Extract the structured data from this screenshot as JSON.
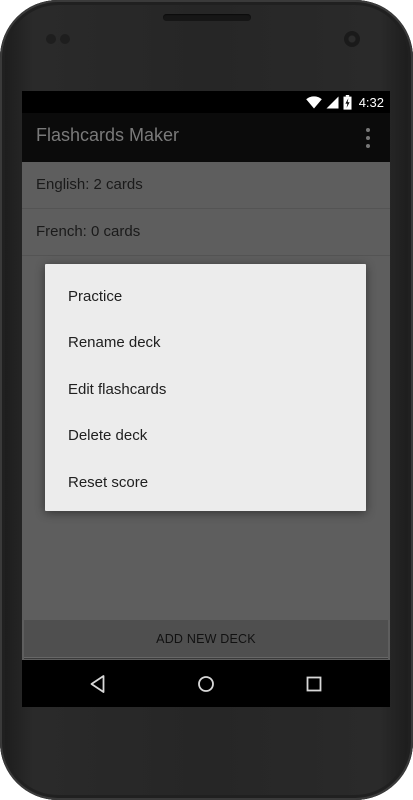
{
  "status_bar": {
    "time": "4:32",
    "icons": [
      "wifi-icon",
      "cell-signal-icon",
      "battery-charging-icon"
    ]
  },
  "action_bar": {
    "title": "Flashcards Maker",
    "overflow_icon": "more-vert-icon"
  },
  "decks": [
    {
      "label": "English: 2 cards"
    },
    {
      "label": "French: 0 cards"
    }
  ],
  "context_menu": {
    "items": [
      {
        "label": "Practice"
      },
      {
        "label": "Rename deck"
      },
      {
        "label": "Edit flashcards"
      },
      {
        "label": "Delete deck"
      },
      {
        "label": "Reset score"
      }
    ]
  },
  "add_deck_button": {
    "label": "ADD NEW DECK"
  },
  "nav_bar": {
    "buttons": [
      "back-icon",
      "home-icon",
      "recents-icon"
    ]
  },
  "colors": {
    "dialog_bg": "#ececec",
    "screen_dim_bg": "#5e5e5e",
    "action_bar_bg": "#0b0b0b"
  }
}
